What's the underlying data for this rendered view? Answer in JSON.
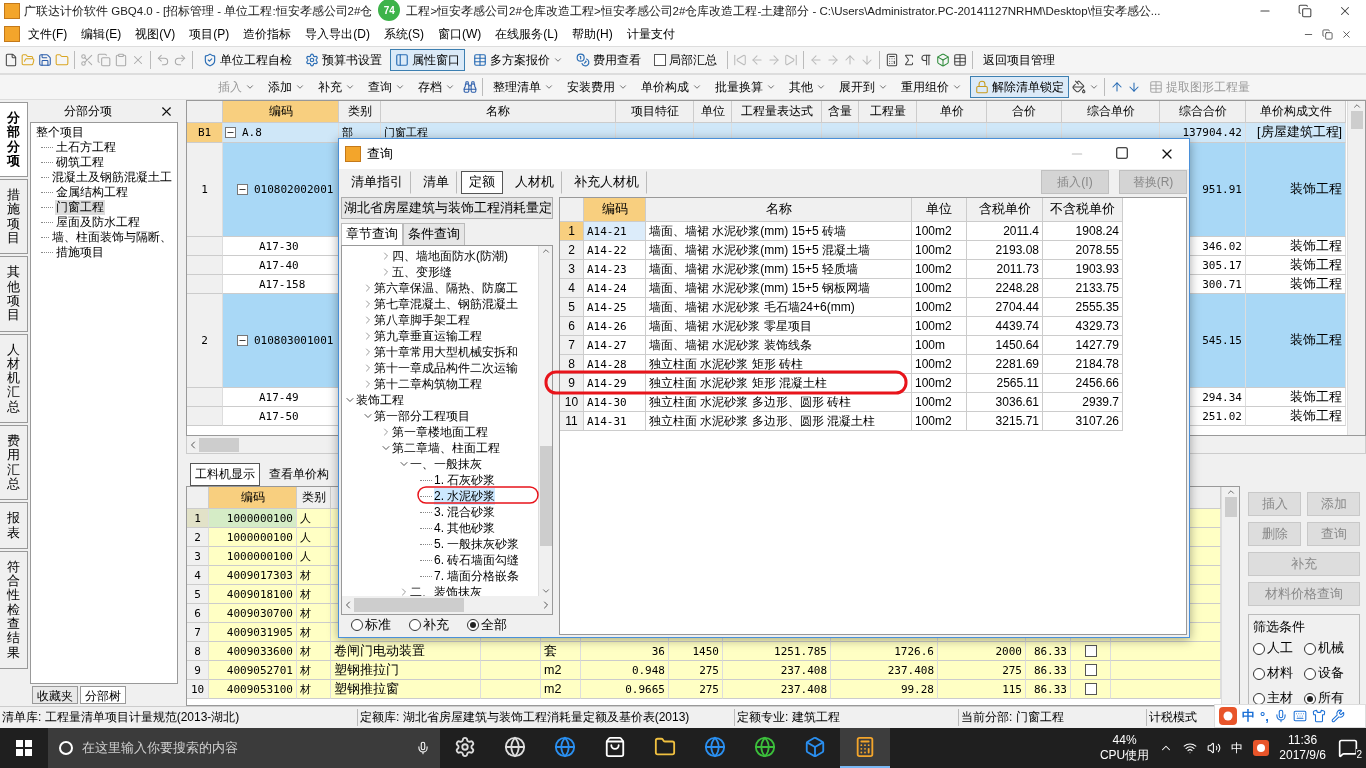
{
  "title_bar": {
    "title": "广联达计价软件 GBQ4.0 - [招标管理 - 单位工程:恒安孝感公司2#仓",
    "badge": "74",
    "title_rest": "工程>恒安孝感公司2#仓库改造工程>恒安孝感公司2#仓库改造工程-土建部分 - C:\\Users\\Administrator.PC-20141127NRHM\\Desktop\\恒安孝感公..."
  },
  "menu": [
    "文件(F)",
    "编辑(E)",
    "视图(V)",
    "项目(P)",
    "造价指标",
    "导入导出(D)",
    "系统(S)",
    "窗口(W)",
    "在线服务(L)",
    "帮助(H)",
    "计量支付"
  ],
  "toolbar": [
    {
      "kind": "button",
      "label": "单位工程自检",
      "pressed": false,
      "dropdown": false
    },
    {
      "kind": "button",
      "label": "预算书设置",
      "pressed": false,
      "dropdown": false
    },
    {
      "kind": "button",
      "label": "属性窗口",
      "pressed": true,
      "dropdown": false
    },
    {
      "kind": "button",
      "label": "多方案报价",
      "pressed": false,
      "dropdown": true
    },
    {
      "kind": "button",
      "label": "费用查看",
      "pressed": false,
      "dropdown": false
    },
    {
      "kind": "check",
      "label": "局部汇总",
      "checked": false
    },
    {
      "kind": "button",
      "label": "返回项目管理",
      "pressed": false,
      "dropdown": false
    }
  ],
  "toolbar2": [
    {
      "label": "插入",
      "disabled": true,
      "dropdown": true,
      "pressed": false
    },
    {
      "label": "添加",
      "disabled": false,
      "dropdown": true,
      "pressed": false
    },
    {
      "label": "补充",
      "disabled": false,
      "dropdown": true,
      "pressed": false
    },
    {
      "label": "查询",
      "disabled": false,
      "dropdown": true,
      "pressed": false
    },
    {
      "label": "存档",
      "disabled": false,
      "dropdown": true,
      "pressed": false
    },
    {
      "label": "整理清单",
      "disabled": false,
      "dropdown": true,
      "pressed": false
    },
    {
      "label": "安装费用",
      "disabled": false,
      "dropdown": true,
      "pressed": false
    },
    {
      "label": "单价构成",
      "disabled": false,
      "dropdown": true,
      "pressed": false
    },
    {
      "label": "批量换算",
      "disabled": false,
      "dropdown": true,
      "pressed": false
    },
    {
      "label": "其他",
      "disabled": false,
      "dropdown": true,
      "pressed": false
    },
    {
      "label": "展开到",
      "disabled": false,
      "dropdown": true,
      "pressed": false
    },
    {
      "label": "重用组价",
      "disabled": false,
      "dropdown": true,
      "pressed": false
    },
    {
      "label": "解除清单锁定",
      "disabled": false,
      "dropdown": false,
      "pressed": true
    },
    {
      "label": "提取图形工程量",
      "disabled": true,
      "dropdown": false,
      "pressed": false
    }
  ],
  "side_tabs": [
    {
      "label": "分部分项",
      "selected": true
    },
    {
      "label": "措施项目",
      "selected": false
    },
    {
      "label": "其他项目",
      "selected": false
    },
    {
      "label": "人材机汇总",
      "selected": false
    },
    {
      "label": "费用汇总",
      "selected": false
    },
    {
      "label": "报表",
      "selected": false
    },
    {
      "label": "符合性检查结果",
      "selected": false
    }
  ],
  "left_panel": {
    "title": "分部分项",
    "tree": {
      "label": "整个项目",
      "children": [
        {
          "label": "土石方工程",
          "selected": false
        },
        {
          "label": "砌筑工程",
          "selected": false
        },
        {
          "label": "混凝土及钢筋混凝土工",
          "selected": false
        },
        {
          "label": "金属结构工程",
          "selected": false
        },
        {
          "label": "门窗工程",
          "selected": true
        },
        {
          "label": "屋面及防水工程",
          "selected": false
        },
        {
          "label": "墙、柱面装饰与隔断、",
          "selected": false
        },
        {
          "label": "措施项目",
          "selected": false
        }
      ]
    },
    "bottom_tabs": [
      {
        "label": "收藏夹",
        "selected": false
      },
      {
        "label": "分部树",
        "selected": true
      }
    ]
  },
  "top_grid": {
    "columns": [
      "编码",
      "类别",
      "名称",
      "项目特征",
      "单位",
      "工程量表达式",
      "含量",
      "工程量",
      "单价",
      "合价",
      "综合单价",
      "综合合价",
      "单价构成文件"
    ],
    "rows": [
      {
        "kind": "section",
        "index": "B1",
        "code": "A.8",
        "expanded": true,
        "type": "部",
        "name": "门窗工程",
        "total": "137904.42",
        "file": "[房屋建筑工程]",
        "selected": true
      },
      {
        "kind": "list",
        "index": "1",
        "code": "010802002001",
        "expanded": true,
        "total": "951.91",
        "file": "装饰工程",
        "selected": false
      },
      {
        "kind": "quota",
        "code": "A17-30",
        "total": "346.02",
        "file": "装饰工程",
        "selected": false
      },
      {
        "kind": "quota",
        "code": "A17-40",
        "total": "305.17",
        "file": "装饰工程",
        "selected": false
      },
      {
        "kind": "quota",
        "code": "A17-158",
        "total": "300.71",
        "file": "装饰工程",
        "selected": false
      },
      {
        "kind": "list",
        "index": "2",
        "code": "010803001001",
        "expanded": true,
        "total": "545.15",
        "file": "装饰工程",
        "selected": false
      },
      {
        "kind": "quota",
        "code": "A17-49",
        "total": "294.34",
        "file": "装饰工程",
        "selected": false
      },
      {
        "kind": "quota",
        "code": "A17-50",
        "total": "251.02",
        "file": "装饰工程",
        "selected": false
      }
    ]
  },
  "lower_tabs": [
    {
      "label": "工料机显示",
      "selected": true
    },
    {
      "label": "查看单价构",
      "selected": false
    }
  ],
  "lower_grid": {
    "columns": [
      "编码",
      "类别"
    ],
    "rows": [
      {
        "index": "1",
        "code": "1000000100",
        "type": "人",
        "selected": true
      },
      {
        "index": "2",
        "code": "1000000100",
        "type": "人",
        "selected": false
      },
      {
        "index": "3",
        "code": "1000000100",
        "type": "人",
        "selected": false
      },
      {
        "index": "4",
        "code": "4009017303",
        "type": "材",
        "selected": false
      },
      {
        "index": "5",
        "code": "4009018100",
        "type": "材",
        "selected": false
      },
      {
        "index": "6",
        "code": "4009030700",
        "type": "材",
        "selected": false
      },
      {
        "index": "7",
        "code": "4009031905",
        "type": "材",
        "selected": false
      },
      {
        "index": "8",
        "code": "4009033600",
        "type": "材",
        "column_4": "卷闸门电动装置",
        "column_6": "套",
        "column_7": "36",
        "column_8": "1450",
        "column_9": "1251.785",
        "column_10": "1726.6",
        "column_11": "2000",
        "column_12": "86.33",
        "checked": false,
        "selected": false
      },
      {
        "index": "9",
        "code": "4009052701",
        "type": "材",
        "column_4": "塑钢推拉门",
        "column_6": "m2",
        "column_7": "0.948",
        "column_8": "275",
        "column_9": "237.408",
        "column_10": "237.408",
        "column_11": "275",
        "column_12": "86.33",
        "checked": false,
        "selected": false
      },
      {
        "index": "10",
        "code": "4009053100",
        "type": "材",
        "column_4": "塑钢推拉窗",
        "column_6": "m2",
        "column_7": "0.9665",
        "column_8": "275",
        "column_9": "237.408",
        "column_10": "99.28",
        "column_11": "115",
        "column_12": "86.33",
        "checked": false,
        "selected": false
      }
    ]
  },
  "right_panel": {
    "buttons": [
      {
        "label": "插入",
        "disabled": true
      },
      {
        "label": "添加",
        "disabled": true
      },
      {
        "label": "删除",
        "disabled": true
      },
      {
        "label": "查询",
        "disabled": true
      },
      {
        "label": "补充",
        "disabled": true
      },
      {
        "label": "材料价格查询",
        "disabled": true
      }
    ],
    "filter_title": "筛选条件",
    "filters": [
      {
        "label": "人工",
        "selected": false
      },
      {
        "label": "机械",
        "selected": false
      },
      {
        "label": "材料",
        "selected": false
      },
      {
        "label": "设备",
        "selected": false
      },
      {
        "label": "主材",
        "selected": false
      },
      {
        "label": "所有",
        "selected": true
      }
    ]
  },
  "dialog": {
    "title": "查询",
    "tabs": [
      {
        "label": "清单指引",
        "selected": false
      },
      {
        "label": "清单",
        "selected": false
      },
      {
        "label": "定额",
        "selected": true
      },
      {
        "label": "人材机",
        "selected": false
      },
      {
        "label": "补充人材机",
        "selected": false
      }
    ],
    "buttons": [
      {
        "label": "插入(I)",
        "disabled": true
      },
      {
        "label": "替换(R)",
        "disabled": true
      }
    ],
    "library": "湖北省房屋建筑与装饰工程消耗量定",
    "search_tabs": [
      {
        "label": "章节查询",
        "selected": true
      },
      {
        "label": "条件查询",
        "selected": false
      }
    ],
    "tree": [
      {
        "children": [
          {
            "children": [
              {
                "label": "四、墙地面防水(防潮)",
                "expanded": false
              },
              {
                "label": "五、变形缝",
                "expanded": false
              }
            ]
          },
          {
            "label": "第六章保温、隔热、防腐工",
            "expanded": false
          },
          {
            "label": "第七章混凝土、钢筋混凝土",
            "expanded": false
          },
          {
            "label": "第八章脚手架工程",
            "expanded": false
          },
          {
            "label": "第九章垂直运输工程",
            "expanded": false
          },
          {
            "label": "第十章常用大型机械安拆和",
            "expanded": false
          },
          {
            "label": "第十一章成品构件二次运输",
            "expanded": false
          },
          {
            "label": "第十二章构筑物工程",
            "expanded": false
          }
        ]
      },
      {
        "label": "装饰工程",
        "expanded": true,
        "children": [
          {
            "label": "第一部分工程项目",
            "expanded": true,
            "children": [
              {
                "label": "第一章楼地面工程",
                "expanded": false
              },
              {
                "label": "第二章墙、柱面工程",
                "expanded": true,
                "children": [
                  {
                    "label": "一、一般抹灰",
                    "expanded": true,
                    "children": [
                      {
                        "label": "1. 石灰砂浆",
                        "selected": false
                      },
                      {
                        "label": "2. 水泥砂浆",
                        "selected": true
                      },
                      {
                        "label": "3. 混合砂浆",
                        "selected": false
                      },
                      {
                        "label": "4. 其他砂浆",
                        "selected": false
                      },
                      {
                        "label": "5. 一般抹灰砂浆",
                        "selected": false
                      },
                      {
                        "label": "6. 砖石墙面勾缝",
                        "selected": false
                      },
                      {
                        "label": "7. 墙面分格嵌条",
                        "selected": false
                      }
                    ]
                  },
                  {
                    "label": "二、装饰抹灰",
                    "expanded": false
                  }
                ]
              }
            ]
          }
        ]
      }
    ],
    "filters": [
      {
        "label": "标准",
        "selected": false
      },
      {
        "label": "补充",
        "selected": false
      },
      {
        "label": "全部",
        "selected": true
      }
    ],
    "table": {
      "columns": [
        "编码",
        "名称",
        "单位",
        "含税单价",
        "不含税单价"
      ],
      "rows": [
        {
          "index": "1",
          "code": "A14-21",
          "name": "墙面、墙裙 水泥砂浆(mm) 15+5 砖墙",
          "unit": "100m2",
          "price": "2011.4",
          "price_ex": "1908.24",
          "selected": true
        },
        {
          "index": "2",
          "code": "A14-22",
          "name": "墙面、墙裙 水泥砂浆(mm) 15+5 混凝土墙",
          "unit": "100m2",
          "price": "2193.08",
          "price_ex": "2078.55",
          "selected": false
        },
        {
          "index": "3",
          "code": "A14-23",
          "name": "墙面、墙裙 水泥砂浆(mm) 15+5 轻质墙",
          "unit": "100m2",
          "price": "2011.73",
          "price_ex": "1903.93",
          "selected": false
        },
        {
          "index": "4",
          "code": "A14-24",
          "name": "墙面、墙裙 水泥砂浆(mm) 15+5 钢板网墙",
          "unit": "100m2",
          "price": "2248.28",
          "price_ex": "2133.75",
          "selected": false
        },
        {
          "index": "5",
          "code": "A14-25",
          "name": "墙面、墙裙 水泥砂浆 毛石墙24+6(mm)",
          "unit": "100m2",
          "price": "2704.44",
          "price_ex": "2555.35",
          "selected": false
        },
        {
          "index": "6",
          "code": "A14-26",
          "name": "墙面、墙裙 水泥砂浆 零星项目",
          "unit": "100m2",
          "price": "4439.74",
          "price_ex": "4329.73",
          "selected": false
        },
        {
          "index": "7",
          "code": "A14-27",
          "name": "墙面、墙裙 水泥砂浆 装饰线条",
          "unit": "100m",
          "price": "1450.64",
          "price_ex": "1427.79",
          "selected": false
        },
        {
          "index": "8",
          "code": "A14-28",
          "name": "独立柱面 水泥砂浆 矩形 砖柱",
          "unit": "100m2",
          "price": "2281.69",
          "price_ex": "2184.78",
          "selected": false
        },
        {
          "index": "9",
          "code": "A14-29",
          "name": "独立柱面 水泥砂浆 矩形 混凝土柱",
          "unit": "100m2",
          "price": "2565.11",
          "price_ex": "2456.66",
          "selected": false
        },
        {
          "index": "10",
          "code": "A14-30",
          "name": "独立柱面 水泥砂浆 多边形、圆形 砖柱",
          "unit": "100m2",
          "price": "3036.61",
          "price_ex": "2939.7",
          "selected": false
        },
        {
          "index": "11",
          "code": "A14-31",
          "name": "独立柱面 水泥砂浆 多边形、圆形 混凝土柱",
          "unit": "100m2",
          "price": "3215.71",
          "price_ex": "3107.26",
          "selected": false
        }
      ]
    }
  },
  "status_bar": [
    "清单库: 工程量清单项目计量规范(2013-湖北)",
    "定额库: 湖北省房屋建筑与装饰工程消耗量定额及基价表(2013)",
    "定额专业: 建筑工程",
    "当前分部: 门窗工程",
    "计税模式"
  ],
  "ime": {
    "lang": "中",
    "punct": "°,"
  },
  "taskbar": {
    "search_placeholder": "在这里输入你要搜索的内容",
    "apps": [
      {
        "selected": false
      },
      {
        "selected": false
      },
      {
        "selected": false
      },
      {
        "selected": false
      },
      {
        "selected": false
      },
      {
        "selected": false
      },
      {
        "selected": false
      },
      {
        "selected": false
      },
      {
        "selected": true
      }
    ],
    "cpu": "44%",
    "cpu_label": "CPU使用",
    "ime": "中",
    "time": "11:36",
    "date": "2017/9/6",
    "notifications": "2"
  }
}
